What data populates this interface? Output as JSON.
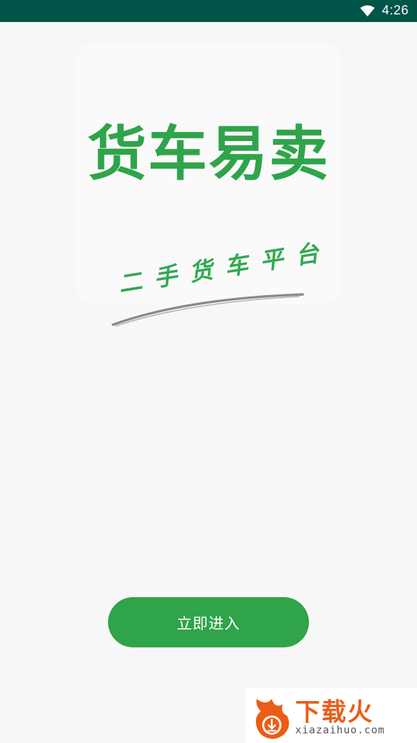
{
  "status_bar": {
    "time": "4:26",
    "icons": [
      "wifi-icon"
    ],
    "background": "#005548"
  },
  "splash": {
    "brand_title": "货车易卖",
    "tagline": "二手货车平台",
    "brand_color": "#2fa44a"
  },
  "enter_button": {
    "label": "立即进入",
    "color": "#2fa44a"
  },
  "watermark": {
    "title": "下载火",
    "domain": "xiazaihuo.com",
    "icon": "flame-download-icon",
    "color": "#ec5c17"
  }
}
